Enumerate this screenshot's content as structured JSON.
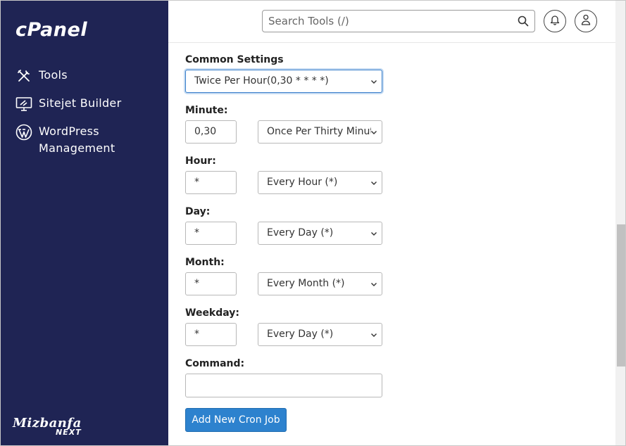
{
  "sidebar": {
    "logo": "cPanel",
    "items": [
      {
        "label": "Tools",
        "icon": "tools-icon"
      },
      {
        "label": "Sitejet Builder",
        "icon": "monitor-icon"
      },
      {
        "label": "WordPress Management",
        "label_line1": "WordPress",
        "label_line2": "Management",
        "icon": "wordpress-icon"
      }
    ],
    "brand_line1": "Mizbanfa",
    "brand_line2": "NEXT"
  },
  "header": {
    "search_placeholder": "Search Tools (/)",
    "icons": [
      "search-icon",
      "bell-icon",
      "user-icon"
    ]
  },
  "form": {
    "common_settings_label": "Common Settings",
    "common_settings_value": "Twice Per Hour(0,30 * * * *)",
    "minute_label": "Minute:",
    "minute_value": "0,30",
    "minute_select": "Once Per Thirty Minutes",
    "hour_label": "Hour:",
    "hour_value": "*",
    "hour_select": "Every Hour (*)",
    "day_label": "Day:",
    "day_value": "*",
    "day_select": "Every Day (*)",
    "month_label": "Month:",
    "month_value": "*",
    "month_select": "Every Month (*)",
    "weekday_label": "Weekday:",
    "weekday_value": "*",
    "weekday_select": "Every Day (*)",
    "command_label": "Command:",
    "command_value": "",
    "submit_label": "Add New Cron Job"
  },
  "colors": {
    "sidebar_bg": "#1f2454",
    "primary_button": "#2d82ce",
    "focus_border": "#3a7fcb"
  }
}
